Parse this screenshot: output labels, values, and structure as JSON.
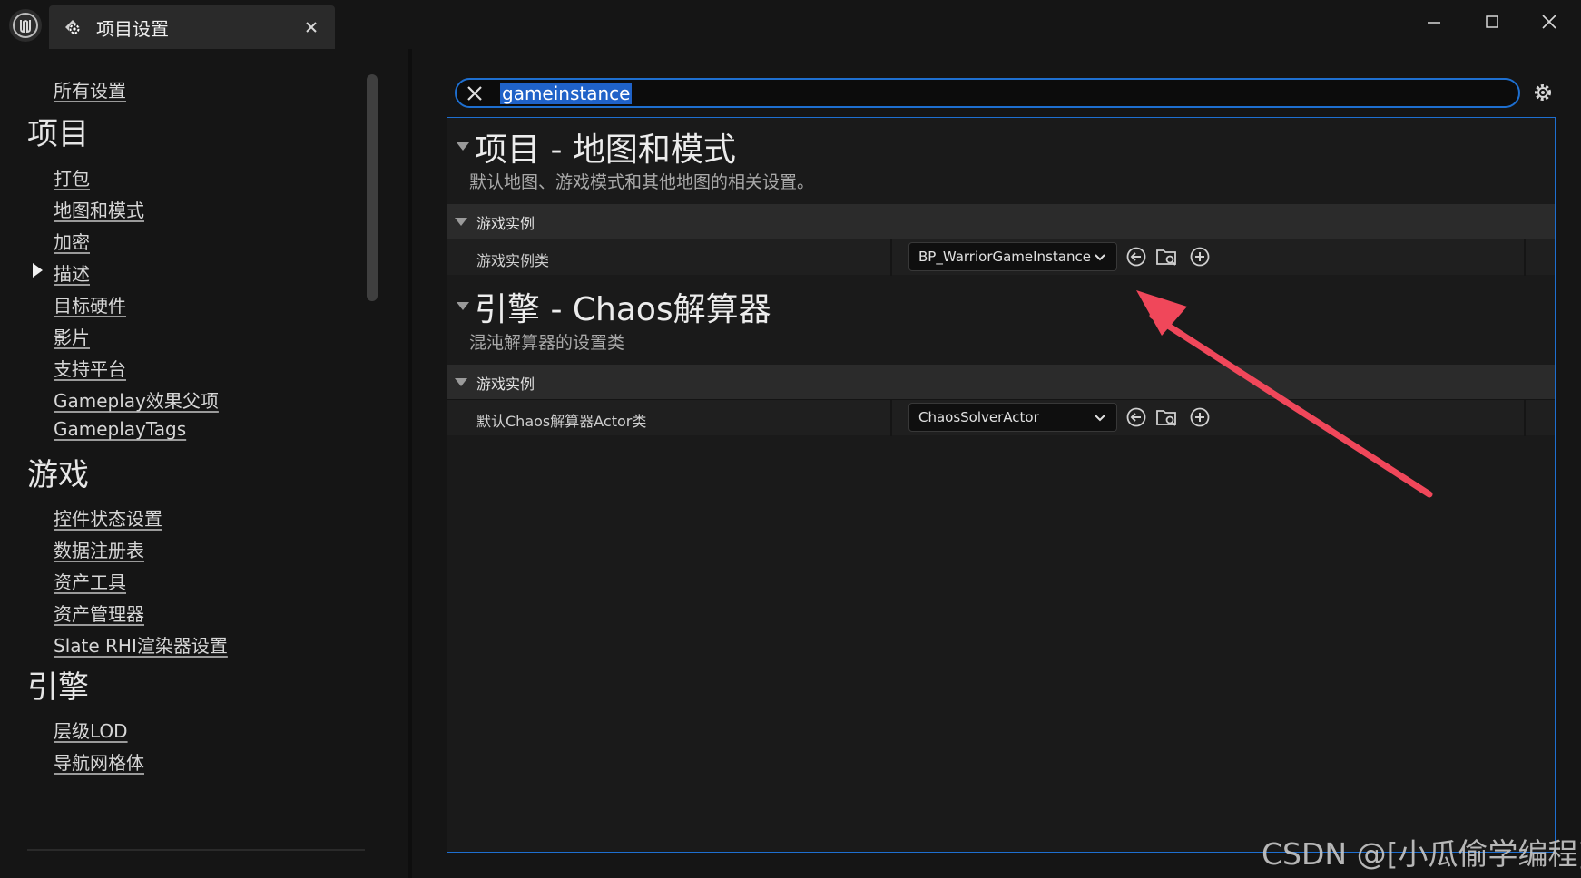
{
  "window": {
    "tab_title": "项目设置",
    "icons": [
      "unreal-logo-icon",
      "settings-gear-icon",
      "close-icon",
      "minimize-icon",
      "maximize-icon"
    ]
  },
  "sidebar": {
    "all_settings": "所有设置",
    "sections": [
      {
        "title": "项目",
        "items": [
          "打包",
          "地图和模式",
          "加密",
          "描述",
          "目标硬件",
          "影片",
          "支持平台",
          "Gameplay效果父项",
          "GameplayTags"
        ]
      },
      {
        "title": "游戏",
        "items": [
          "控件状态设置",
          "数据注册表",
          "资产工具",
          "资产管理器",
          "Slate RHI渲染器设置"
        ]
      },
      {
        "title": "引擎",
        "items": [
          "层级LOD",
          "导航网格体"
        ]
      }
    ]
  },
  "search": {
    "value": "gameinstance"
  },
  "categories": [
    {
      "title": "项目 - 地图和模式",
      "description": "默认地图、游戏模式和其他地图的相关设置。",
      "subsection": "游戏实例",
      "property": {
        "label": "游戏实例类",
        "value": "BP_WarriorGameInstance"
      }
    },
    {
      "title": "引擎 - Chaos解算器",
      "description": "混沌解算器的设置类",
      "subsection": "游戏实例",
      "property": {
        "label": "默认Chaos解算器Actor类",
        "value": "ChaosSolverActor"
      }
    }
  ],
  "watermark": "CSDN @[小瓜偷学编程]",
  "colors": {
    "accent": "#1e6fd0",
    "selection": "#1f62c8",
    "annotation_arrow": "#f0475a"
  }
}
